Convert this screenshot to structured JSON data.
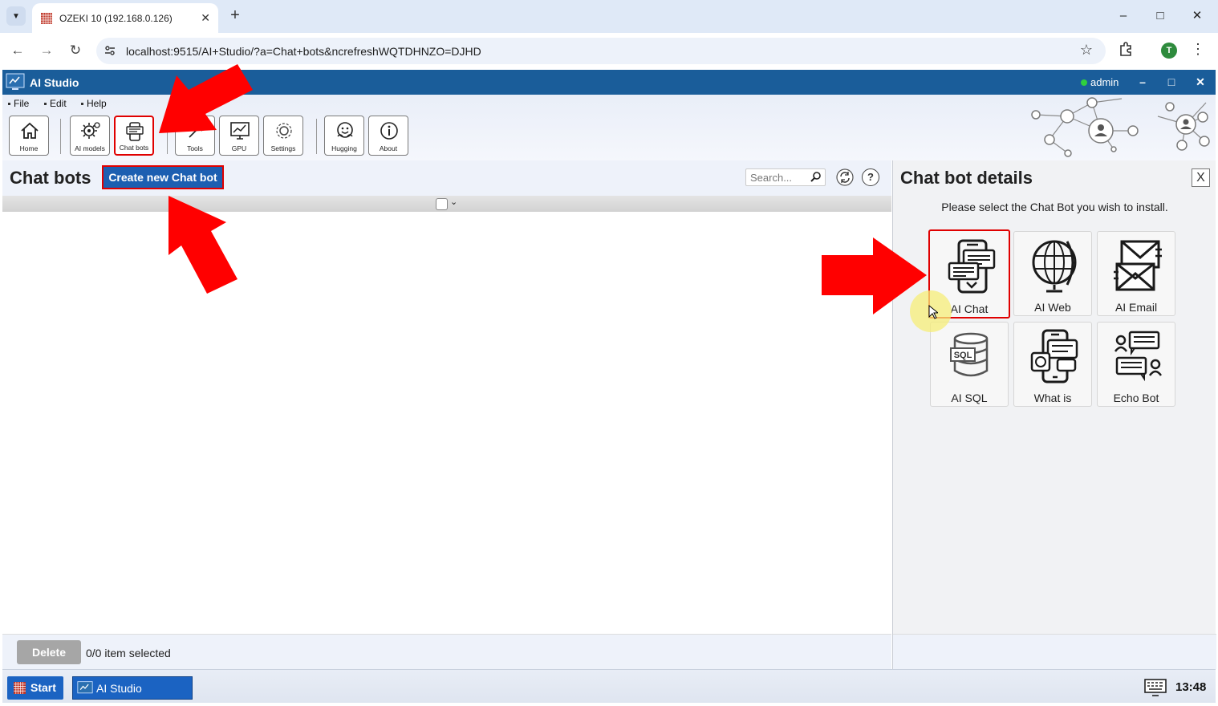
{
  "browser": {
    "tab_title": "OZEKI 10 (192.168.0.126)",
    "url": "localhost:9515/AI+Studio/?a=Chat+bots&ncrefreshWQTDHNZO=DJHD",
    "profile_initial": "T"
  },
  "app": {
    "title": "AI Studio",
    "user": "admin",
    "menu": [
      "File",
      "Edit",
      "Help"
    ],
    "toolbar": {
      "home": "Home",
      "ai_models": "AI models",
      "chat_bots": "Chat bots",
      "tools": "Tools",
      "gpu": "GPU",
      "settings": "Settings",
      "hugging": "Hugging",
      "about": "About"
    }
  },
  "chatbots_panel": {
    "title": "Chat bots",
    "create_button": "Create new Chat bot",
    "search_placeholder": "Search...",
    "help_label": "?",
    "delete_button": "Delete",
    "selection_status": "0/0 item selected"
  },
  "details_panel": {
    "title": "Chat bot details",
    "close_label": "X",
    "instruction": "Please select the Chat Bot you wish to install.",
    "bots": [
      {
        "label": "AI Chat",
        "icon": "chat-phone-icon",
        "selected": true
      },
      {
        "label": "AI Web",
        "icon": "globe-icon"
      },
      {
        "label": "AI Email",
        "icon": "email-icon"
      },
      {
        "label": "AI SQL",
        "icon": "sql-database-icon"
      },
      {
        "label": "What is",
        "icon": "whatsapp-phone-icon"
      },
      {
        "label": "Echo Bot",
        "icon": "echo-conversation-icon"
      }
    ]
  },
  "taskbar": {
    "start": "Start",
    "task": "AI Studio",
    "clock": "13:48"
  },
  "colors": {
    "titlebar": "#1a5d9a",
    "create_button": "#1c5fb1",
    "highlight": "#e00000"
  }
}
